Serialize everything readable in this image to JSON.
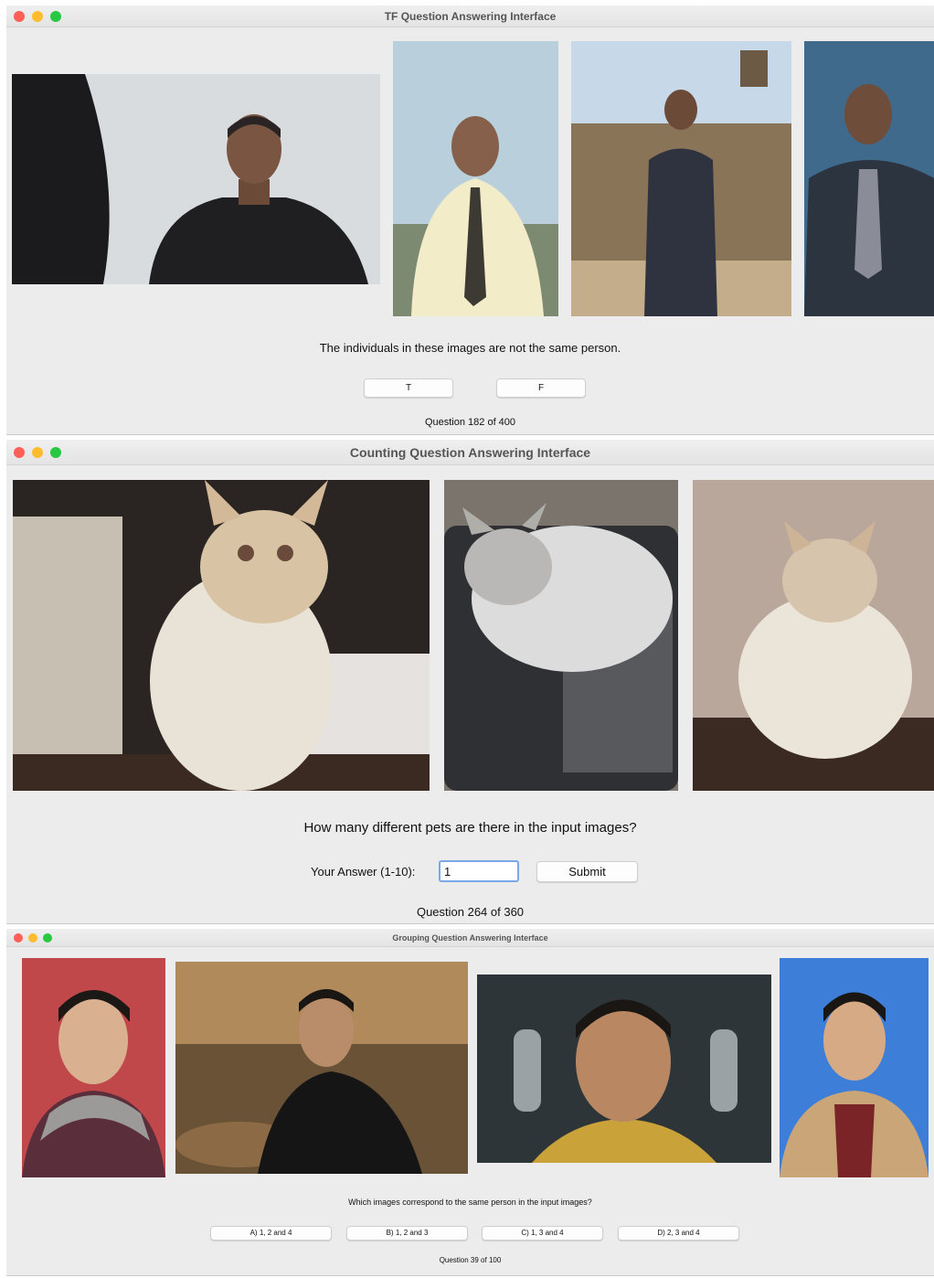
{
  "tf_window": {
    "title": "TF Question Answering Interface",
    "images": [
      "man-in-dark-suit-portrait",
      "man-in-yellow-shirt-and-tie",
      "man-in-suit-western-town",
      "man-in-coat-with-glasses"
    ],
    "question": "The individuals in these images are not the same person.",
    "buttons": {
      "true_label": "T",
      "false_label": "F"
    },
    "counter": "Question 182 of 400"
  },
  "counting_window": {
    "title": "Counting Question Answering Interface",
    "images": [
      "cream-cat-sitting-indoors",
      "white-grey-cat-in-suitcase",
      "cream-cat-on-wood-floor"
    ],
    "question": "How many different pets are there in the input images?",
    "answer_label": "Your Answer (1-10):",
    "answer_value": "1",
    "submit_label": "Submit",
    "counter": "Question 264 of 360"
  },
  "grouping_window": {
    "title": "Grouping Question Answering Interface",
    "images": [
      "man-with-scarf-event-backdrop",
      "man-in-black-shirt-table",
      "man-in-yellow-uniform",
      "man-at-d23-expo"
    ],
    "question": "Which images correspond to the same person in the input images?",
    "options": [
      "A) 1, 2 and 4",
      "B) 1, 2 and 3",
      "C) 1, 3 and 4",
      "D) 2, 3 and 4"
    ],
    "counter": "Question 39 of 100"
  },
  "colors": {
    "window_bg": "#ececec",
    "close": "#fe5f57",
    "minimize": "#febc2e",
    "zoom": "#28c840",
    "input_focus": "#7aa7e8"
  }
}
